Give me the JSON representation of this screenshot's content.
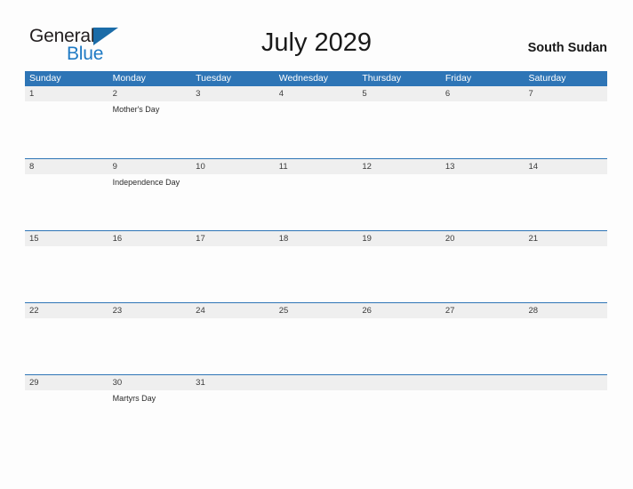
{
  "brand": {
    "name_part1": "General",
    "name_part2": "Blue",
    "flag_icon": "blue-triangle-flag",
    "color_dark": "#231f20",
    "color_blue": "#1f7ac4"
  },
  "header": {
    "title": "July 2029",
    "region": "South Sudan"
  },
  "theme": {
    "header_blue": "#2e75b6",
    "band_gray": "#efefef",
    "page_background": "#fdfdfd",
    "text_dark": "#1a1a1a"
  },
  "calendar": {
    "month": "July",
    "year": "2029",
    "weekdays": [
      "Sunday",
      "Monday",
      "Tuesday",
      "Wednesday",
      "Thursday",
      "Friday",
      "Saturday"
    ],
    "weeks": [
      {
        "days": [
          {
            "number": "1",
            "events": []
          },
          {
            "number": "2",
            "events": [
              "Mother's Day"
            ]
          },
          {
            "number": "3",
            "events": []
          },
          {
            "number": "4",
            "events": []
          },
          {
            "number": "5",
            "events": []
          },
          {
            "number": "6",
            "events": []
          },
          {
            "number": "7",
            "events": []
          }
        ]
      },
      {
        "days": [
          {
            "number": "8",
            "events": []
          },
          {
            "number": "9",
            "events": [
              "Independence Day"
            ]
          },
          {
            "number": "10",
            "events": []
          },
          {
            "number": "11",
            "events": []
          },
          {
            "number": "12",
            "events": []
          },
          {
            "number": "13",
            "events": []
          },
          {
            "number": "14",
            "events": []
          }
        ]
      },
      {
        "days": [
          {
            "number": "15",
            "events": []
          },
          {
            "number": "16",
            "events": []
          },
          {
            "number": "17",
            "events": []
          },
          {
            "number": "18",
            "events": []
          },
          {
            "number": "19",
            "events": []
          },
          {
            "number": "20",
            "events": []
          },
          {
            "number": "21",
            "events": []
          }
        ]
      },
      {
        "days": [
          {
            "number": "22",
            "events": []
          },
          {
            "number": "23",
            "events": []
          },
          {
            "number": "24",
            "events": []
          },
          {
            "number": "25",
            "events": []
          },
          {
            "number": "26",
            "events": []
          },
          {
            "number": "27",
            "events": []
          },
          {
            "number": "28",
            "events": []
          }
        ]
      },
      {
        "days": [
          {
            "number": "29",
            "events": []
          },
          {
            "number": "30",
            "events": [
              "Martyrs Day"
            ]
          },
          {
            "number": "31",
            "events": []
          },
          {
            "number": "",
            "events": []
          },
          {
            "number": "",
            "events": []
          },
          {
            "number": "",
            "events": []
          },
          {
            "number": "",
            "events": []
          }
        ]
      }
    ]
  }
}
